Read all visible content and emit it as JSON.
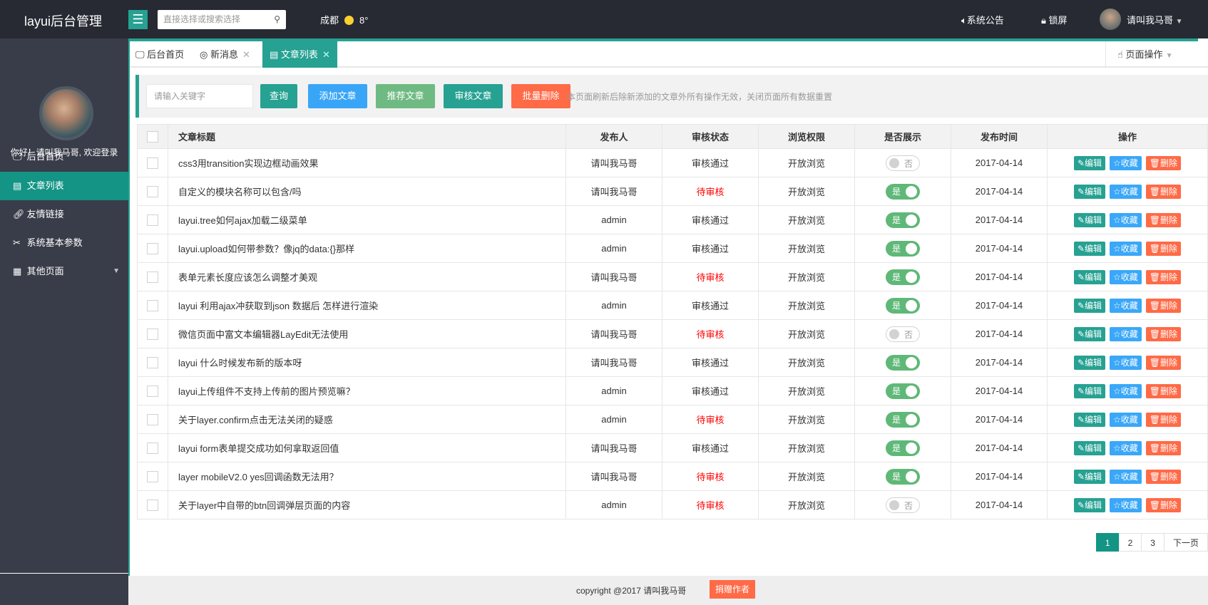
{
  "header": {
    "logo": "layui后台管理",
    "search_placeholder": "直接选择或搜索选择",
    "city": "成都",
    "temp": "8°",
    "notice": "系统公告",
    "lock": "锁屏",
    "user": "请叫我马哥"
  },
  "sidebar": {
    "greeting": "你好！请叫我马哥, 欢迎登录",
    "items": [
      {
        "label": "后台首页"
      },
      {
        "label": "文章列表"
      },
      {
        "label": "友情链接"
      },
      {
        "label": "系统基本参数"
      },
      {
        "label": "其他页面"
      }
    ]
  },
  "tabs": [
    {
      "label": "后台首页"
    },
    {
      "label": "新消息"
    },
    {
      "label": "文章列表"
    }
  ],
  "page_ops": "页面操作",
  "toolbar": {
    "keyword_placeholder": "请输入关键字",
    "query": "查询",
    "add": "添加文章",
    "recommend": "推荐文章",
    "audit": "审核文章",
    "batch_delete": "批量删除",
    "note": "本页面刷新后除新添加的文章外所有操作无效，关闭页面所有数据重置"
  },
  "table": {
    "headers": [
      "文章标题",
      "发布人",
      "审核状态",
      "浏览权限",
      "是否展示",
      "发布时间",
      "操作"
    ],
    "switch_on": "是",
    "switch_off": "否",
    "actions": {
      "edit": "编辑",
      "collect": "收藏",
      "delete": "删除"
    },
    "rows": [
      {
        "title": "css3用transition实现边框动画效果",
        "author": "请叫我马哥",
        "status": "审核通过",
        "perm": "开放浏览",
        "show": false,
        "date": "2017-04-14"
      },
      {
        "title": "自定义的模块名称可以包含/吗",
        "author": "请叫我马哥",
        "status": "待审核",
        "perm": "开放浏览",
        "show": true,
        "date": "2017-04-14"
      },
      {
        "title": "layui.tree如何ajax加载二级菜单",
        "author": "admin",
        "status": "审核通过",
        "perm": "开放浏览",
        "show": true,
        "date": "2017-04-14"
      },
      {
        "title": "layui.upload如何带参数？像jq的data:{}那样",
        "author": "admin",
        "status": "审核通过",
        "perm": "开放浏览",
        "show": true,
        "date": "2017-04-14"
      },
      {
        "title": "表单元素长度应该怎么调整才美观",
        "author": "请叫我马哥",
        "status": "待审核",
        "perm": "开放浏览",
        "show": true,
        "date": "2017-04-14"
      },
      {
        "title": "layui 利用ajax冲获取到json 数据后 怎样进行渲染",
        "author": "admin",
        "status": "审核通过",
        "perm": "开放浏览",
        "show": true,
        "date": "2017-04-14"
      },
      {
        "title": "微信页面中富文本编辑器LayEdit无法使用",
        "author": "请叫我马哥",
        "status": "待审核",
        "perm": "开放浏览",
        "show": false,
        "date": "2017-04-14"
      },
      {
        "title": "layui 什么时候发布新的版本呀",
        "author": "请叫我马哥",
        "status": "审核通过",
        "perm": "开放浏览",
        "show": true,
        "date": "2017-04-14"
      },
      {
        "title": "layui上传组件不支持上传前的图片预览嘛？",
        "author": "admin",
        "status": "审核通过",
        "perm": "开放浏览",
        "show": true,
        "date": "2017-04-14"
      },
      {
        "title": "关于layer.confirm点击无法关闭的疑惑",
        "author": "admin",
        "status": "待审核",
        "perm": "开放浏览",
        "show": true,
        "date": "2017-04-14"
      },
      {
        "title": "layui form表单提交成功如何拿取返回值",
        "author": "请叫我马哥",
        "status": "审核通过",
        "perm": "开放浏览",
        "show": true,
        "date": "2017-04-14"
      },
      {
        "title": "layer mobileV2.0 yes回调函数无法用？",
        "author": "请叫我马哥",
        "status": "待审核",
        "perm": "开放浏览",
        "show": true,
        "date": "2017-04-14"
      },
      {
        "title": "关于layer中自带的btn回调弹层页面的内容",
        "author": "admin",
        "status": "待审核",
        "perm": "开放浏览",
        "show": false,
        "date": "2017-04-14"
      }
    ]
  },
  "pagination": {
    "pages": [
      "1",
      "2",
      "3"
    ],
    "current": "1",
    "next": "下一页"
  },
  "footer": {
    "copyright": "copyright @2017 请叫我马哥",
    "donate": "捐赠作者"
  },
  "colors": {
    "teal": "#26a192",
    "blue": "#1e9fff",
    "green": "#5fb878",
    "red": "#ff5722"
  }
}
